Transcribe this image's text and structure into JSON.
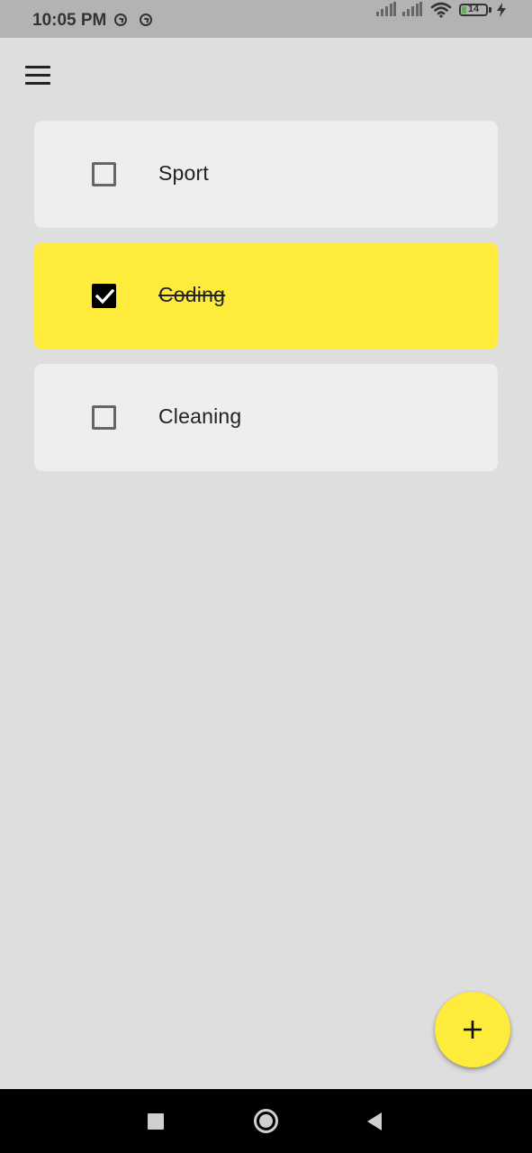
{
  "status_bar": {
    "time": "10:05 PM",
    "battery_level": "14",
    "icons": [
      "app-notification-icon",
      "app-notification-icon",
      "signal-icon",
      "signal-icon",
      "wifi-icon",
      "battery-icon",
      "charging-icon"
    ]
  },
  "header": {
    "menu_icon": "hamburger-menu-icon"
  },
  "tasks": [
    {
      "label": "Sport",
      "done": false
    },
    {
      "label": "Coding",
      "done": true
    },
    {
      "label": "Cleaning",
      "done": false
    }
  ],
  "fab": {
    "icon": "plus-icon"
  },
  "nav_bar": {
    "icons": [
      "recents-icon",
      "home-icon",
      "back-icon"
    ]
  },
  "colors": {
    "accent": "#ffeb3b",
    "background": "#dedede",
    "card": "#eeeeee",
    "status_bar": "#b3b3b3",
    "nav_bar": "#000000"
  }
}
